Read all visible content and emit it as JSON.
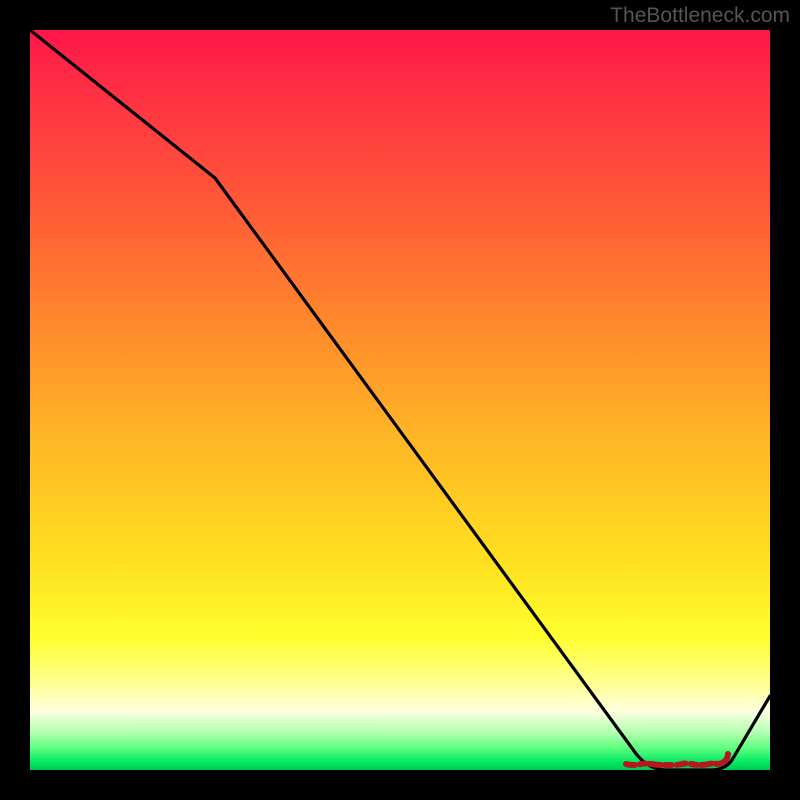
{
  "watermark": "TheBottleneck.com",
  "chart_data": {
    "type": "line",
    "title": "",
    "xlabel": "",
    "ylabel": "",
    "ylim": [
      0,
      100
    ],
    "series": [
      {
        "name": "curve",
        "x": [
          0,
          25,
          82,
          86,
          92,
          100
        ],
        "y": [
          100,
          80,
          2,
          0,
          0,
          10
        ]
      }
    ],
    "highlight": {
      "name": "minimum-band",
      "x_range": [
        81,
        92
      ],
      "y": 0
    },
    "gradient_stops": [
      {
        "pos": 0.0,
        "color": "#ff1648"
      },
      {
        "pos": 0.5,
        "color": "#ffb626"
      },
      {
        "pos": 0.85,
        "color": "#ffff60"
      },
      {
        "pos": 1.0,
        "color": "#00d858"
      }
    ]
  }
}
